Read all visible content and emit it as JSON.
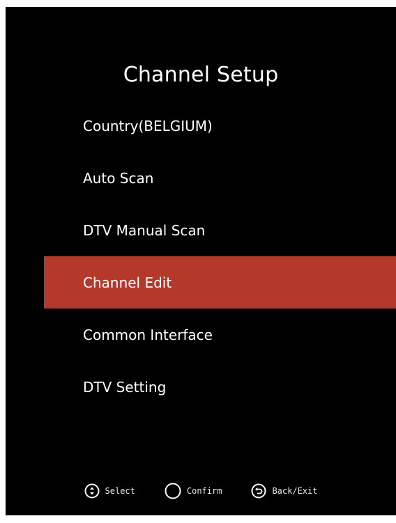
{
  "colors": {
    "background": "#000000",
    "text": "#ffffff",
    "highlight": "#b4392b"
  },
  "title": "Channel Setup",
  "menu": {
    "selected_index": 3,
    "items": [
      {
        "label": "Country(BELGIUM)"
      },
      {
        "label": "Auto Scan"
      },
      {
        "label": "DTV Manual Scan"
      },
      {
        "label": "Channel Edit"
      },
      {
        "label": "Common Interface"
      },
      {
        "label": "DTV Setting"
      }
    ]
  },
  "footer": {
    "select": {
      "icon": "up-down-icon",
      "label": "Select"
    },
    "confirm": {
      "icon": "circle-icon",
      "label": "Confirm"
    },
    "back": {
      "icon": "back-arrow-icon",
      "label": "Back/Exit"
    }
  }
}
